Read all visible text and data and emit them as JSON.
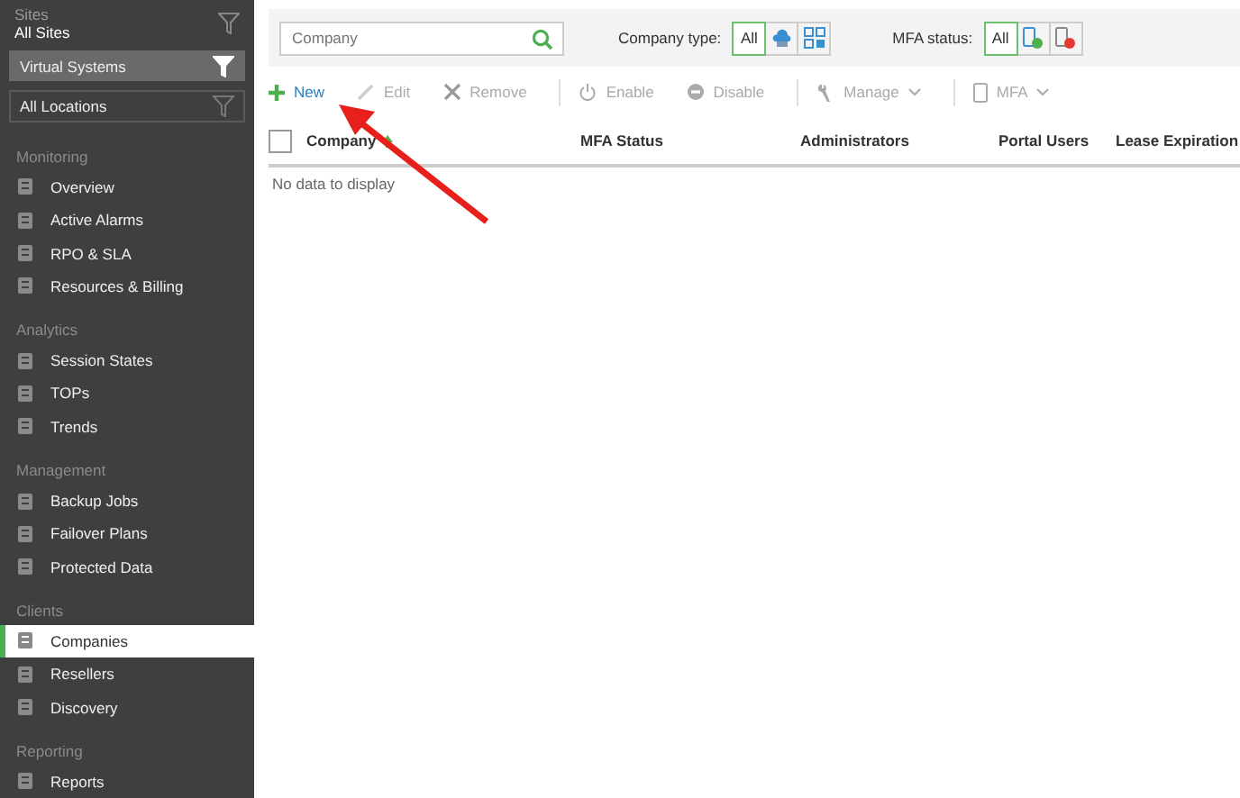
{
  "sidebar": {
    "sites_label": "Sites",
    "sites_value": "All Sites",
    "filters": [
      {
        "label": "Virtual Systems",
        "active": true
      },
      {
        "label": "All Locations",
        "active": false
      }
    ],
    "sections": [
      {
        "title": "Monitoring",
        "items": [
          {
            "label": "Overview",
            "selected": false
          },
          {
            "label": "Active Alarms",
            "selected": false
          },
          {
            "label": "RPO & SLA",
            "selected": false
          },
          {
            "label": "Resources & Billing",
            "selected": false
          }
        ]
      },
      {
        "title": "Analytics",
        "items": [
          {
            "label": "Session States",
            "selected": false
          },
          {
            "label": "TOPs",
            "selected": false
          },
          {
            "label": "Trends",
            "selected": false
          }
        ]
      },
      {
        "title": "Management",
        "items": [
          {
            "label": "Backup Jobs",
            "selected": false
          },
          {
            "label": "Failover Plans",
            "selected": false
          },
          {
            "label": "Protected Data",
            "selected": false
          }
        ]
      },
      {
        "title": "Clients",
        "items": [
          {
            "label": "Companies",
            "selected": true
          },
          {
            "label": "Resellers",
            "selected": false
          },
          {
            "label": "Discovery",
            "selected": false
          }
        ]
      },
      {
        "title": "Reporting",
        "items": [
          {
            "label": "Reports",
            "selected": false
          }
        ]
      }
    ]
  },
  "filter_bar": {
    "search": {
      "placeholder": "Company"
    },
    "groups": [
      {
        "label": "Company type:",
        "options": [
          {
            "kind": "text",
            "label": "All",
            "selected": true
          },
          {
            "kind": "cloud",
            "selected": false
          },
          {
            "kind": "grid",
            "selected": false
          }
        ]
      },
      {
        "label": "MFA status:",
        "options": [
          {
            "kind": "text",
            "label": "All",
            "selected": true
          },
          {
            "kind": "mfa-on",
            "selected": false
          },
          {
            "kind": "mfa-off",
            "selected": false
          }
        ]
      }
    ]
  },
  "toolbar": [
    [
      {
        "kind": "add",
        "label": "New",
        "disabled": false
      },
      {
        "kind": "edit",
        "label": "Edit",
        "disabled": true
      },
      {
        "kind": "remove",
        "label": "Remove",
        "disabled": true
      }
    ],
    [
      {
        "kind": "enable",
        "label": "Enable",
        "disabled": true
      },
      {
        "kind": "disable",
        "label": "Disable",
        "disabled": true
      }
    ],
    [
      {
        "kind": "manage",
        "label": "Manage",
        "disabled": true,
        "dropdown": true
      }
    ],
    [
      {
        "kind": "mfa",
        "label": "MFA",
        "disabled": true,
        "dropdown": true
      }
    ]
  ],
  "table": {
    "select_all": {
      "checked": false
    },
    "columns": [
      {
        "label": "Company",
        "sorted": true
      },
      {
        "label": "MFA Status",
        "sorted": false
      },
      {
        "label": "Administrators",
        "sorted": false
      },
      {
        "label": "Portal Users",
        "sorted": false
      },
      {
        "label": "Lease Expiration",
        "sorted": false
      }
    ],
    "empty_message": "No data to display"
  }
}
